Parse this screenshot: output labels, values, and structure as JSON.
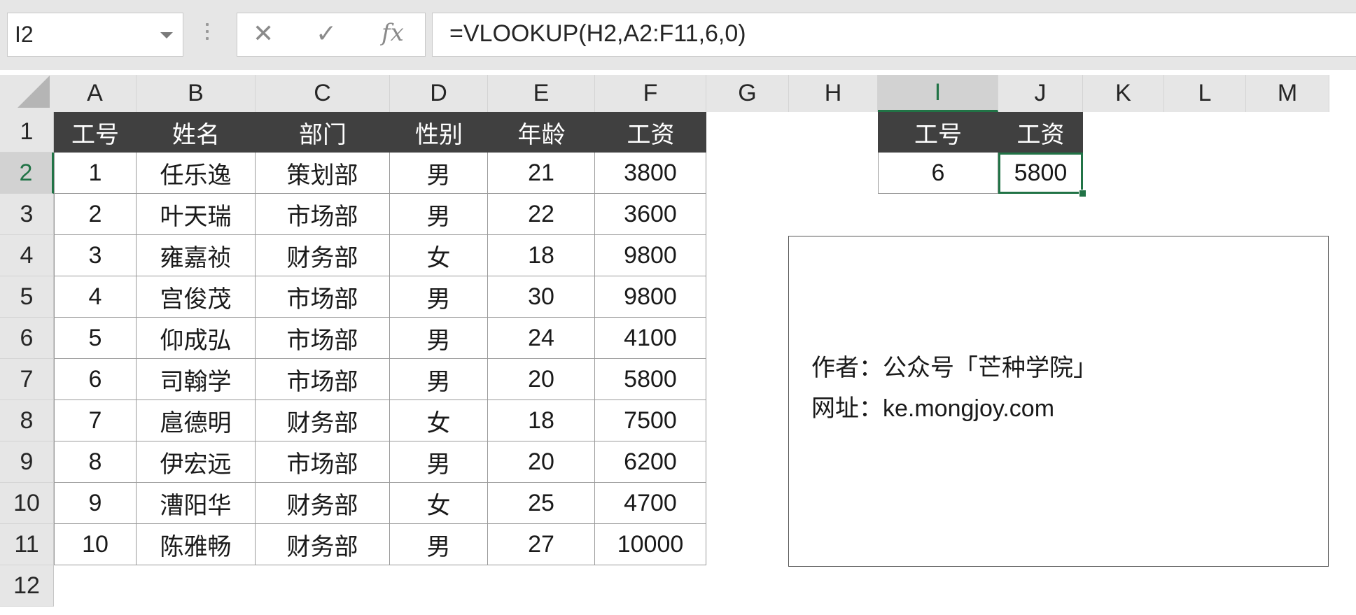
{
  "name_box": {
    "value": "I2"
  },
  "formula_bar": {
    "cancel_glyph": "✕",
    "enter_glyph": "✓",
    "fx_label": "fx",
    "formula": "=VLOOKUP(H2,A2:F11,6,0)"
  },
  "columns": [
    "A",
    "B",
    "C",
    "D",
    "E",
    "F",
    "G",
    "H",
    "I",
    "J",
    "K",
    "L",
    "M"
  ],
  "rows": [
    "1",
    "2",
    "3",
    "4",
    "5",
    "6",
    "7",
    "8",
    "9",
    "10",
    "11",
    "12"
  ],
  "selected_column": "I",
  "selected_row": "2",
  "table": {
    "headers": [
      "工号",
      "姓名",
      "部门",
      "性别",
      "年龄",
      "工资"
    ],
    "rows": [
      [
        "1",
        "任乐逸",
        "策划部",
        "男",
        "21",
        "3800"
      ],
      [
        "2",
        "叶天瑞",
        "市场部",
        "男",
        "22",
        "3600"
      ],
      [
        "3",
        "雍嘉祯",
        "财务部",
        "女",
        "18",
        "9800"
      ],
      [
        "4",
        "宫俊茂",
        "市场部",
        "男",
        "30",
        "9800"
      ],
      [
        "5",
        "仰成弘",
        "市场部",
        "男",
        "24",
        "4100"
      ],
      [
        "6",
        "司翰学",
        "市场部",
        "男",
        "20",
        "5800"
      ],
      [
        "7",
        "扈德明",
        "财务部",
        "女",
        "18",
        "7500"
      ],
      [
        "8",
        "伊宏远",
        "市场部",
        "男",
        "20",
        "6200"
      ],
      [
        "9",
        "漕阳华",
        "财务部",
        "女",
        "25",
        "4700"
      ],
      [
        "10",
        "陈雅畅",
        "财务部",
        "男",
        "27",
        "10000"
      ]
    ]
  },
  "lookup": {
    "headers": [
      "工号",
      "工资"
    ],
    "id_value": "6",
    "result_value": "5800"
  },
  "textbox": {
    "line1": "作者：公众号「芒种学院」",
    "line2": "网址：ke.mongjoy.com"
  },
  "colors": {
    "header_fill": "#404040",
    "selection_accent": "#217346"
  }
}
